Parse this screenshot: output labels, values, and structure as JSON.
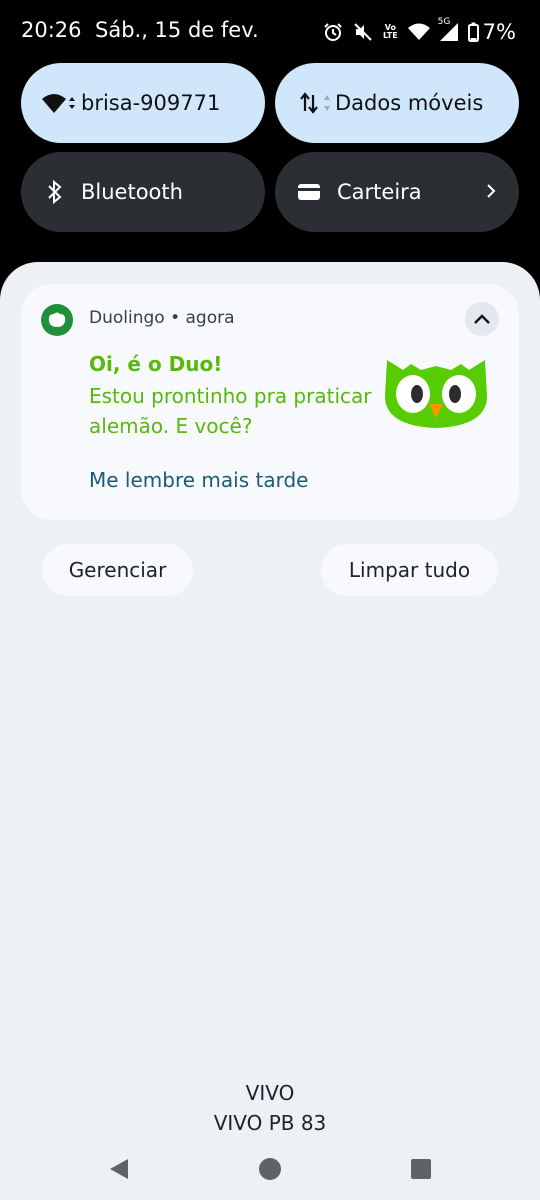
{
  "status_bar": {
    "time": "20:26",
    "date": "Sáb., 15 de fev.",
    "volte_line1": "Vo",
    "volte_line2": "LTE",
    "network": "5G",
    "battery": "7%"
  },
  "quick_tiles": [
    {
      "label": "brisa-909771",
      "icon": "wifi-icon",
      "state": "active"
    },
    {
      "label": "Dados móveis",
      "icon": "mobile-data-icon",
      "state": "active"
    },
    {
      "label": "Bluetooth",
      "icon": "bluetooth-icon",
      "state": "inactive"
    },
    {
      "label": "Carteira",
      "icon": "wallet-icon",
      "state": "inactive"
    }
  ],
  "notification": {
    "app": "Duolingo",
    "time": "agora",
    "header": "Duolingo • agora",
    "title": "Oi, é o Duo!",
    "body": "Estou prontinho pra praticar alemão. E você?",
    "action": "Me lembre mais tarde"
  },
  "buttons": {
    "manage": "Gerenciar",
    "clear_all": "Limpar tudo"
  },
  "carrier": {
    "line1": "VIVO",
    "line2": "VIVO PB 83"
  },
  "colors": {
    "accent_green": "#58b80c",
    "tile_active": "#cfe6fb",
    "tile_inactive": "#2b2f33",
    "shade_bg": "#edf1f6"
  }
}
